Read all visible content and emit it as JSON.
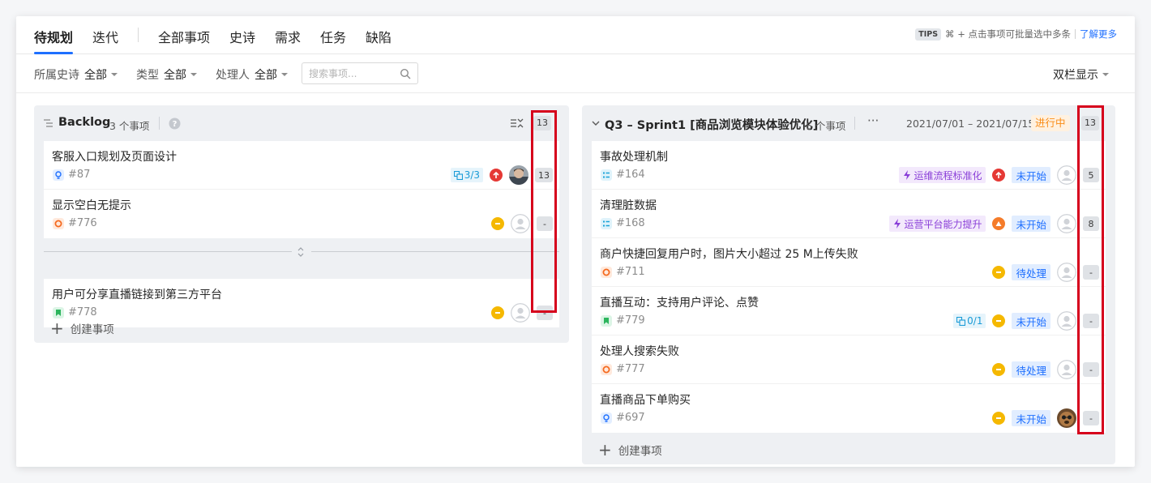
{
  "nav": {
    "tabs": [
      "待规划",
      "迭代",
      "全部事项",
      "史诗",
      "需求",
      "任务",
      "缺陷"
    ],
    "tips_badge": "TIPS",
    "tips_text": "⌘ + 点击事项可批量选中多条",
    "tips_link": "了解更多"
  },
  "filters": {
    "epic_label": "所属史诗",
    "epic_value": "全部",
    "type_label": "类型",
    "type_value": "全部",
    "assignee_label": "处理人",
    "assignee_value": "全部",
    "search_placeholder": "搜索事项...",
    "view_mode": "双栏显示"
  },
  "backlog": {
    "title": "Backlog",
    "count": "3 个事项",
    "total_points": "13",
    "items": [
      {
        "title": "客服入口规划及页面设计",
        "id": "#87",
        "type": "requirement",
        "subtasks": "3/3",
        "priority": "highest",
        "points": "13",
        "avatar": "photo"
      },
      {
        "title": "显示空白无提示",
        "id": "#776",
        "type": "bug",
        "priority": "medium",
        "points": "-",
        "avatar": "empty"
      }
    ],
    "below_divider": [
      {
        "title": "用户可分享直播链接到第三方平台",
        "id": "#778",
        "type": "story",
        "priority": "medium",
        "points": "-",
        "avatar": "empty"
      }
    ],
    "create_label": "创建事项"
  },
  "sprint": {
    "title": "Q3 – Sprint1 [商品浏览模块体验优化]",
    "count": "6 个事项",
    "more": "···",
    "date_range": "2021/07/01 – 2021/07/15",
    "status": "进行中",
    "total_points": "13",
    "items": [
      {
        "title": "事故处理机制",
        "id": "#164",
        "type": "task",
        "epic": "运维流程标准化",
        "priority": "highest",
        "state": "未开始",
        "points": "5",
        "avatar": "empty"
      },
      {
        "title": "清理脏数据",
        "id": "#168",
        "type": "task",
        "epic": "运营平台能力提升",
        "priority": "high",
        "state": "未开始",
        "points": "8",
        "avatar": "empty"
      },
      {
        "title": "商户快捷回复用户时，图片大小超过 25 M上传失败",
        "id": "#711",
        "type": "bug",
        "priority": "medium",
        "state": "待处理",
        "points": "-",
        "avatar": "empty"
      },
      {
        "title": "直播互动：支持用户评论、点赞",
        "id": "#779",
        "type": "story",
        "subtasks": "0/1",
        "priority": "medium",
        "state": "未开始",
        "points": "-",
        "avatar": "empty"
      },
      {
        "title": "处理人搜索失败",
        "id": "#777",
        "type": "bug",
        "priority": "medium",
        "state": "待处理",
        "points": "-",
        "avatar": "empty"
      },
      {
        "title": "直播商品下单购买",
        "id": "#697",
        "type": "requirement",
        "priority": "medium",
        "state": "未开始",
        "points": "-",
        "avatar": "dog"
      }
    ],
    "create_label": "创建事项"
  },
  "colors": {
    "accent": "#1e6fff",
    "highlight": "#d6001c",
    "priority_highest": "#e53935",
    "priority_high": "#f57c2a",
    "priority_medium": "#f5b800",
    "status_in_progress": "#fa8c16"
  }
}
